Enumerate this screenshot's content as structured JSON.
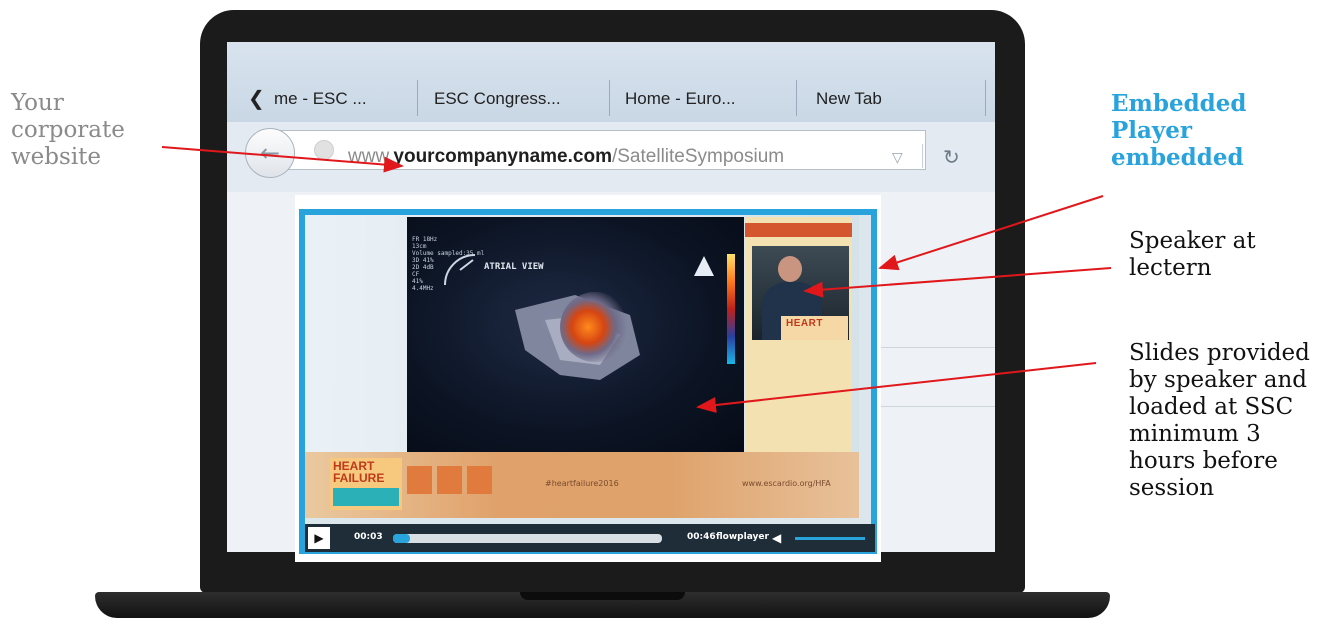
{
  "browser": {
    "tabs": [
      "me - ESC ...",
      "ESC Congress...",
      "Home - Euro...",
      "New Tab"
    ],
    "url": {
      "domain_prefix": "www.",
      "domain": "yourcompanyname.com",
      "path": "/SatelliteSymposium"
    }
  },
  "player": {
    "slide_caption": "ATRIAL VIEW",
    "slide_info": [
      "FR 18Hz",
      "13cm",
      "Volume sampled:35 ml",
      "3D 41%",
      "2D 4dB",
      "CF",
      "41%",
      "4.4MHz"
    ],
    "lectern_text": "HEART",
    "banner_logo": "HEART\nFAILURE",
    "banner_hashtag": "#heartfailure2016",
    "banner_url": "www.escardio.org/HFA",
    "current_time": "00:03",
    "duration": "00:46",
    "brand": "flowplayer",
    "progress_fraction": 0.065
  },
  "annotations": {
    "corporate": "Your corporate website",
    "embedded": "Embedded Player embedded",
    "speaker": "Speaker at lectern",
    "slides": "Slides provided by speaker and loaded at SSC minimum 3 hours before session"
  },
  "colors": {
    "accent": "#29a3dc",
    "arrow": "#e0171b"
  }
}
